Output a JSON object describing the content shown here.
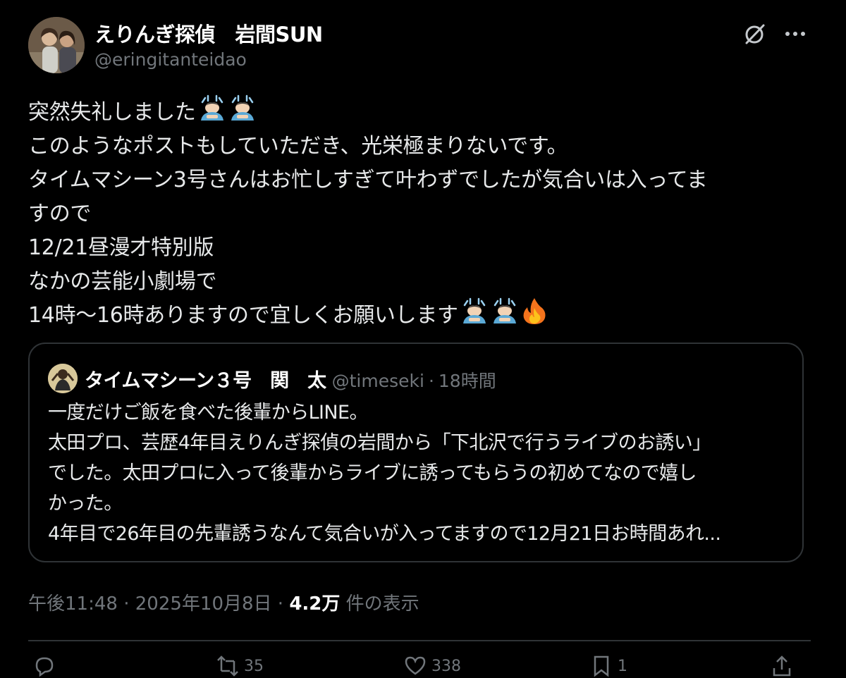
{
  "author": {
    "display_name": "えりんぎ探偵　岩間SUN",
    "handle": "@eringitanteidao"
  },
  "tweet": {
    "lines": [
      "突然失礼しました",
      "このようなポストもしていただき、光栄極まりないです。",
      "タイムマシーン3号さんはお忙しすぎて叶わずでしたが気合いは入ってま",
      "すので",
      "12/21昼漫才特別版",
      "なかの芸能小劇場で",
      "14時～16時ありますので宜しくお願いします"
    ]
  },
  "quote": {
    "display_name": "タイムマシーン３号　関　太",
    "handle": "@timeseki",
    "separator": "·",
    "time": "18時間",
    "lines": [
      "一度だけご飯を食べた後輩からLINE。",
      "太田プロ、芸歴4年目えりんぎ探偵の岩間から「下北沢で行うライブのお誘い」",
      "でした。太田プロに入って後輩からライブに誘ってもらうの初めてなので嬉し",
      "かった。",
      "4年目で26年目の先輩誘うなんて気合いが入ってますので12月21日お時間あれ..."
    ]
  },
  "meta": {
    "time": "午後11:48",
    "sep1": " · ",
    "date": "2025年10月8日",
    "sep2": " · ",
    "views": "4.2万",
    "views_label": " 件の表示"
  },
  "actions": {
    "reply_count": "",
    "repost_count": "35",
    "like_count": "338",
    "bookmark_count": "1"
  },
  "icons": {
    "grok": "grok-icon",
    "more": "more-dots-icon",
    "emoji_bow": "person-bowing-emoji",
    "emoji_fire": "fire-emoji"
  },
  "colors": {
    "background": "#000000",
    "text": "#e7e9ea",
    "secondary": "#71767b",
    "border": "#2f3336"
  }
}
